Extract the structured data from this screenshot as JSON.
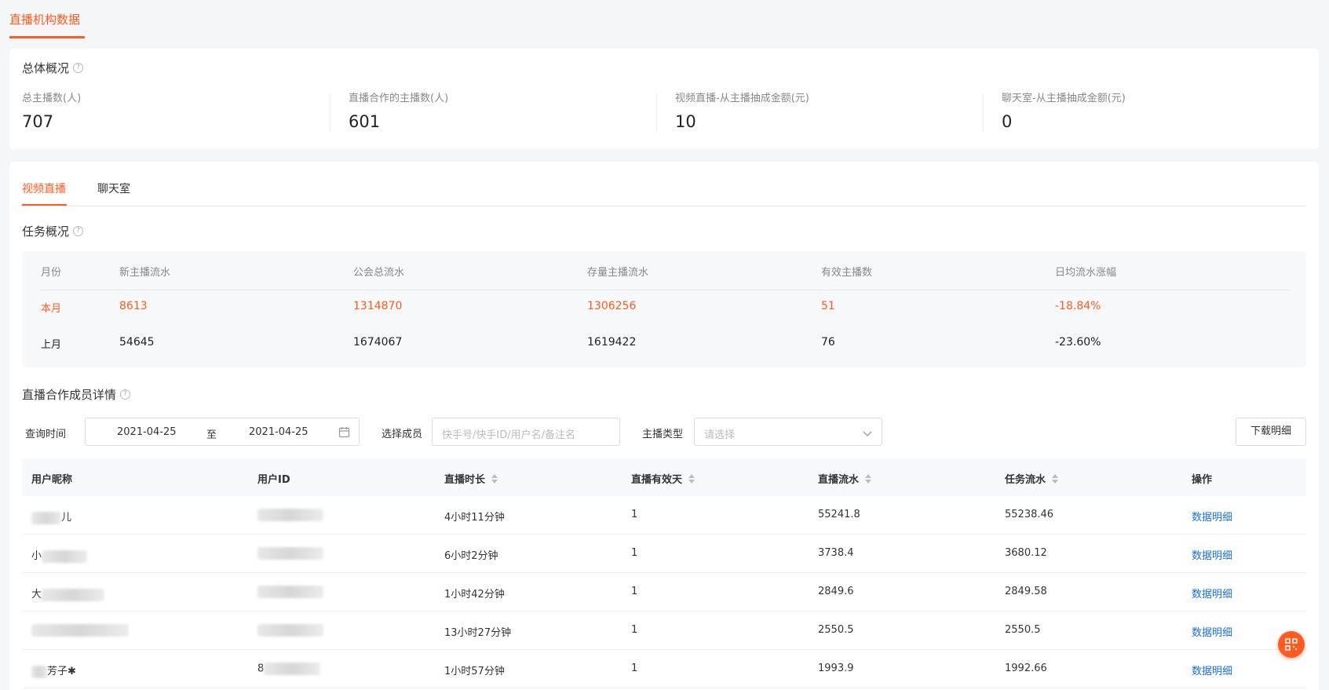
{
  "page_tab": {
    "label": "直播机构数据"
  },
  "overview": {
    "title": "总体概况",
    "stats": [
      {
        "label": "总主播数(人)",
        "value": "707"
      },
      {
        "label": "直播合作的主播数(人)",
        "value": "601"
      },
      {
        "label": "视频直播-从主播抽成金额(元)",
        "value": "10"
      },
      {
        "label": "聊天室-从主播抽成金额(元)",
        "value": "0"
      }
    ]
  },
  "sub_tabs": [
    {
      "label": "视频直播",
      "active": true
    },
    {
      "label": "聊天室",
      "active": false
    }
  ],
  "task": {
    "title": "任务概况",
    "columns": [
      "月份",
      "新主播流水",
      "公会总流水",
      "存量主播流水",
      "有效主播数",
      "日均流水涨幅"
    ],
    "rows": [
      {
        "month": "本月",
        "new_flow": "8613",
        "total_flow": "1314870",
        "stock_flow": "1306256",
        "valid_count": "51",
        "daily_growth": "-18.84%"
      },
      {
        "month": "上月",
        "new_flow": "54645",
        "total_flow": "1674067",
        "stock_flow": "1619422",
        "valid_count": "76",
        "daily_growth": "-23.60%"
      }
    ]
  },
  "members": {
    "title": "直播合作成员详情",
    "filters": {
      "time_label": "查询时间",
      "date_start": "2021-04-25",
      "date_sep": "至",
      "date_end": "2021-04-25",
      "member_label": "选择成员",
      "member_placeholder": "快手号/快手ID/用户名/备注名",
      "type_label": "主播类型",
      "type_placeholder": "请选择",
      "download_label": "下载明细"
    },
    "columns": [
      "用户昵称",
      "用户ID",
      "直播时长",
      "直播有效天",
      "直播流水",
      "任务流水",
      "操作"
    ],
    "rows": [
      {
        "nickname": "儿",
        "user_id": "",
        "duration": "4小时11分钟",
        "valid_days": "1",
        "live_flow": "55241.8",
        "task_flow": "55238.46",
        "action": "数据明细"
      },
      {
        "nickname": "小",
        "user_id": "",
        "duration": "6小时2分钟",
        "valid_days": "1",
        "live_flow": "3738.4",
        "task_flow": "3680.12",
        "action": "数据明细"
      },
      {
        "nickname": "大",
        "user_id": "",
        "duration": "1小时42分钟",
        "valid_days": "1",
        "live_flow": "2849.6",
        "task_flow": "2849.58",
        "action": "数据明细"
      },
      {
        "nickname": "",
        "user_id": "",
        "duration": "13小时27分钟",
        "valid_days": "1",
        "live_flow": "2550.5",
        "task_flow": "2550.5",
        "action": "数据明细"
      },
      {
        "nickname": "芳子",
        "user_id": "8",
        "duration": "1小时57分钟",
        "valid_days": "1",
        "live_flow": "1993.9",
        "task_flow": "1992.66",
        "action": "数据明细"
      }
    ]
  },
  "accent_color": "#ff5a1f",
  "link_color": "#1a6fe0"
}
